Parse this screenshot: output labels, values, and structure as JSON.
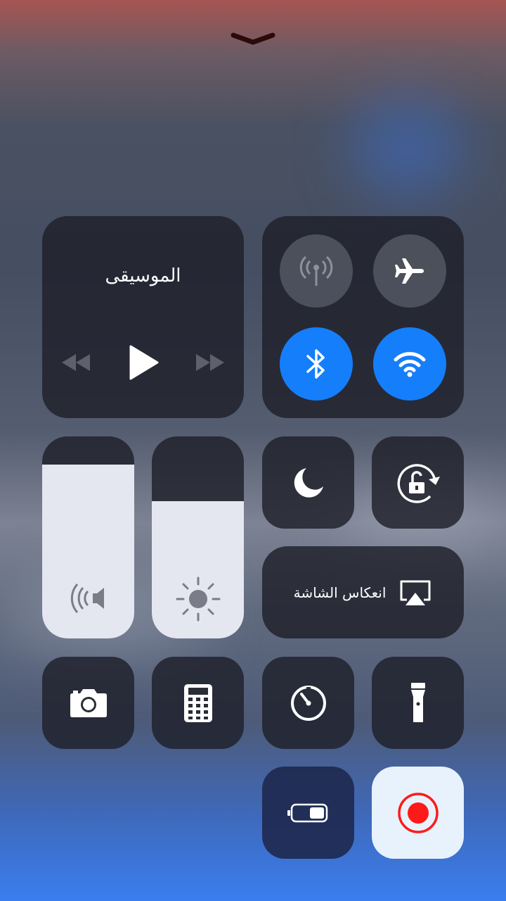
{
  "music": {
    "title": "الموسيقى"
  },
  "connectivity": {
    "cellular": {
      "icon": "antenna-icon",
      "state": "off"
    },
    "airplane": {
      "icon": "airplane-icon",
      "state": "off"
    },
    "bluetooth": {
      "icon": "bluetooth-icon",
      "state": "on"
    },
    "wifi": {
      "icon": "wifi-icon",
      "state": "on"
    }
  },
  "sliders": {
    "volume": {
      "icon": "speaker-icon",
      "level": 0.86
    },
    "brightness": {
      "icon": "sun-icon",
      "level": 0.68
    }
  },
  "toggles": {
    "do_not_disturb": {
      "icon": "moon-icon"
    },
    "orientation_lock": {
      "icon": "rotation-lock-icon"
    }
  },
  "screen_mirroring": {
    "label": "انعكاس الشاشة",
    "icon": "airplay-icon"
  },
  "shortcuts": [
    {
      "icon": "camera-icon"
    },
    {
      "icon": "calculator-icon"
    },
    {
      "icon": "timer-icon"
    },
    {
      "icon": "flashlight-icon"
    },
    {
      "icon": "low-power-icon"
    },
    {
      "icon": "screen-record-icon"
    }
  ],
  "colors": {
    "accent_blue": "#157efb",
    "record_red": "#ff1a1a",
    "tile_dark": "#1e202a"
  }
}
